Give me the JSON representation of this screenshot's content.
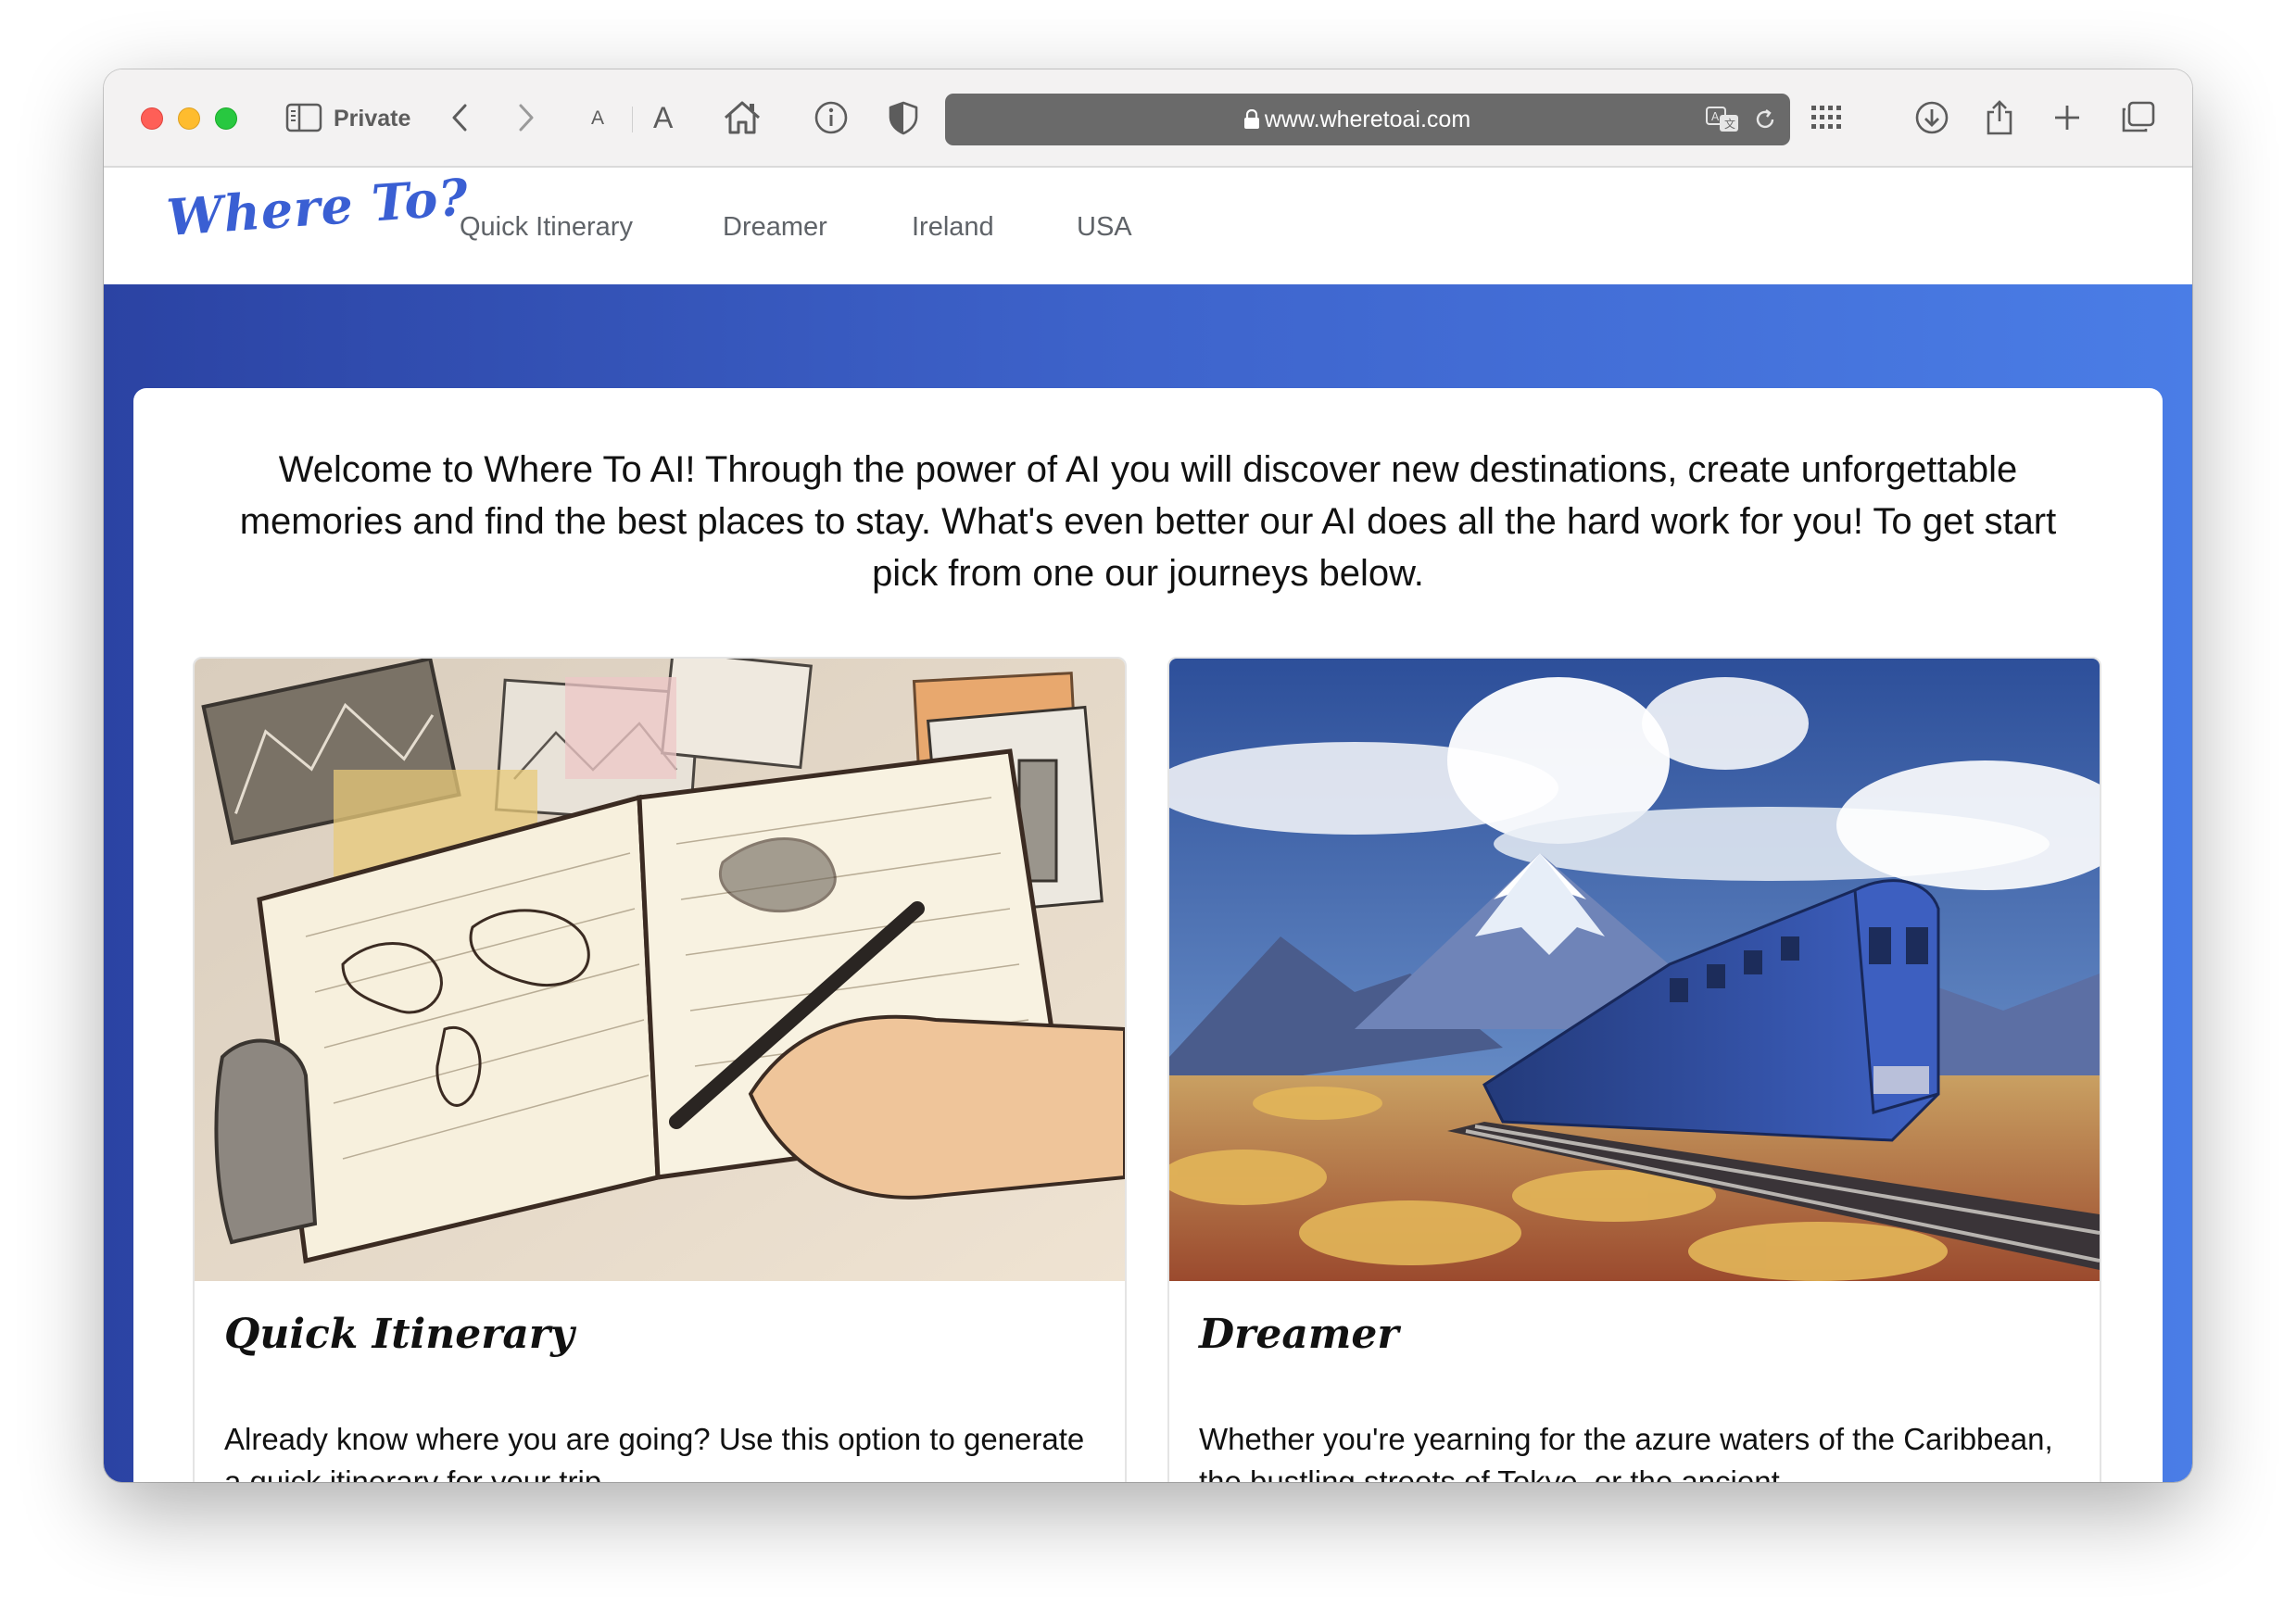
{
  "browser": {
    "mode_label": "Private",
    "url": "www.wheretoai.com",
    "font_small_label": "A",
    "font_large_label": "A"
  },
  "site": {
    "logo": "Where To?",
    "nav": [
      {
        "label": "Quick Itinerary"
      },
      {
        "label": "Dreamer"
      },
      {
        "label": "Ireland"
      },
      {
        "label": "USA"
      }
    ]
  },
  "main": {
    "welcome_text": "Welcome to Where To AI! Through the power of AI you will discover new destinations, create unforgettable memories and find the best places to stay. What's even better our AI does all the hard work for you! To get start pick from one our journeys below.",
    "cards": [
      {
        "title": "Quick Itinerary",
        "description": "Already know where you are going? Use this option to generate a quick itinerary for your trip."
      },
      {
        "title": "Dreamer",
        "description": "Whether you're yearning for the azure waters of the Caribbean, the bustling streets of Tokyo, or the ancient"
      }
    ]
  },
  "colors": {
    "accent": "#3a5fd3",
    "hero_start": "#2b43a3",
    "hero_end": "#4a7de6"
  }
}
